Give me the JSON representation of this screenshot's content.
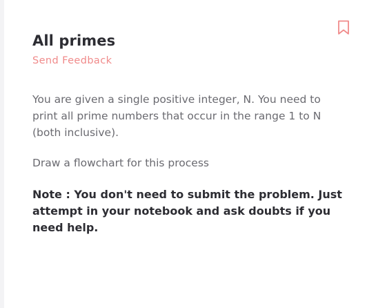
{
  "problem": {
    "title": "All primes",
    "feedback_link": "Send Feedback",
    "description": "You are given a single positive integer, N. You need to print all prime numbers that occur in the range 1 to N (both inclusive).",
    "instruction": "Draw a flowchart for this process",
    "note": "Note : You don't need to submit the problem. Just attempt in your notebook and ask doubts if you need help."
  },
  "icons": {
    "bookmark": "bookmark-icon"
  },
  "colors": {
    "accent": "#f08a8a",
    "title": "#2d2d33",
    "body_text": "#6a6a70",
    "background": "#ffffff"
  }
}
